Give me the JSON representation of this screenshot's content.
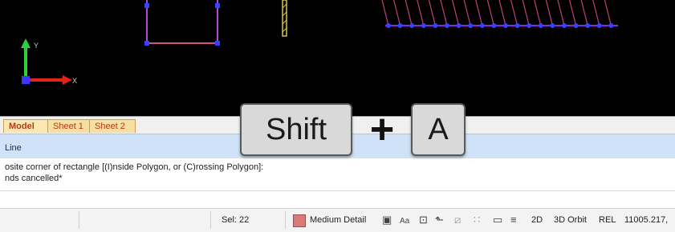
{
  "tabs": {
    "model": "Model",
    "sheet1": "Sheet 1",
    "sheet2": "Sheet 2"
  },
  "command": {
    "title": "Line",
    "history": [
      "osite corner of rectangle [(I)nside Polygon, or (C)rossing Polygon]:",
      "nds cancelled*"
    ]
  },
  "status": {
    "selection": "Sel: 22",
    "detail": "Medium Detail",
    "detail_color": "#d97a78",
    "view_2d": "2D",
    "orbit": "3D Orbit",
    "rel": "REL",
    "coordinates": "11005.217,"
  },
  "overlay": {
    "key1": "Shift",
    "plus": "+",
    "key2": "A"
  },
  "axis": {
    "y_label": "Y",
    "x_label": "X"
  },
  "icons": [
    "cube-icon",
    "text-style-icon",
    "snap-icon",
    "ortho-icon",
    "polar-icon",
    "grid-icon",
    "rectangle-icon",
    "lineweight-icon"
  ]
}
